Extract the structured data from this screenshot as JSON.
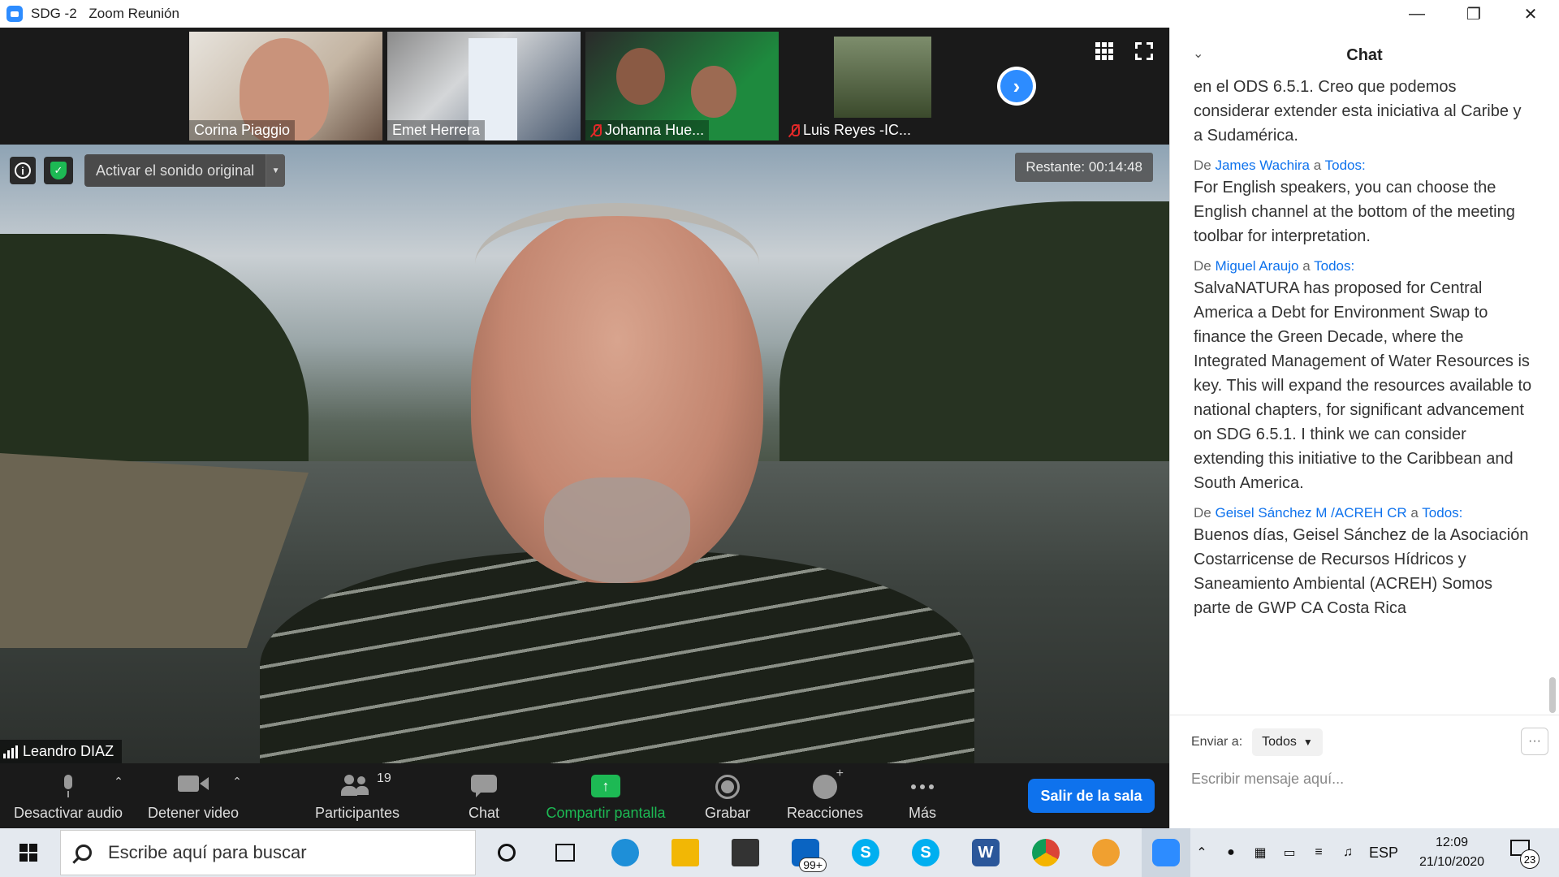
{
  "window": {
    "title": "SDG -2",
    "app_name": "Zoom Reunión",
    "controls": [
      "minimize",
      "restore",
      "close"
    ]
  },
  "gallery": {
    "participants": [
      {
        "name": "Corina Piaggio",
        "muted": false
      },
      {
        "name": "Emet Herrera",
        "muted": false
      },
      {
        "name": "Johanna Hue...",
        "muted": true
      },
      {
        "name": "Luis Reyes -IC...",
        "muted": true
      }
    ]
  },
  "video": {
    "original_sound_label": "Activar el sonido original",
    "remaining": "Restante: 00:14:48",
    "speaker_name": "Leandro DIAZ"
  },
  "toolbar": {
    "mute_label": "Desactivar audio",
    "video_label": "Detener video",
    "participants_label": "Participantes",
    "participants_count": "19",
    "chat_label": "Chat",
    "share_label": "Compartir pantalla",
    "record_label": "Grabar",
    "reactions_label": "Reacciones",
    "more_label": "Más",
    "leave_label": "Salir de la sala",
    "share_color": "#1db954",
    "leave_color": "#0e72ed"
  },
  "chat": {
    "title": "Chat",
    "from_prefix": "De",
    "to_word": "a",
    "partial_text": "en el ODS 6.5.1. Creo que podemos considerar extender esta iniciativa al Caribe y a Sudamérica.",
    "messages": [
      {
        "sender": "James Wachira",
        "recipient": "Todos:",
        "text": "For English speakers, you can choose the English channel at the bottom of the meeting toolbar for interpretation."
      },
      {
        "sender": "Miguel Araujo",
        "recipient": "Todos:",
        "text": "SalvaNATURA has proposed for Central America a Debt for Environment Swap to finance the Green Decade, where the Integrated Management of Water Resources is key. This will expand the resources available to national chapters, for significant advancement on SDG 6.5.1. I think we can consider extending this initiative to the Caribbean and South America."
      },
      {
        "sender": "Geisel Sánchez M /ACREH CR",
        "recipient": "Todos:",
        "text": "Buenos días, Geisel Sánchez de la Asociación Costarricense de Recursos Hídricos y Saneamiento Ambiental (ACREH) Somos parte de GWP CA Costa Rica"
      }
    ],
    "send_to_label": "Enviar a:",
    "send_to_value": "Todos",
    "input_placeholder": "Escribir mensaje aquí..."
  },
  "taskbar": {
    "search_placeholder": "Escribe aquí para buscar",
    "apps": [
      {
        "name": "edge",
        "color": "#1e8fd8"
      },
      {
        "name": "file-explorer",
        "color": "#f2b705"
      },
      {
        "name": "store",
        "color": "#333333"
      },
      {
        "name": "mail",
        "color": "#0a64c2",
        "badge": "99+"
      },
      {
        "name": "skype",
        "color": "#00aff0",
        "glyph": "S"
      },
      {
        "name": "skype-business",
        "color": "#00aff0",
        "glyph": "S"
      },
      {
        "name": "word",
        "color": "#2b579a",
        "glyph": "W"
      },
      {
        "name": "chrome",
        "color": "#db4437"
      },
      {
        "name": "paint",
        "color": "#f0a030"
      },
      {
        "name": "zoom",
        "color": "#2d8cff"
      }
    ],
    "language": "ESP",
    "time": "12:09",
    "date": "21/10/2020",
    "notifications": "23"
  }
}
